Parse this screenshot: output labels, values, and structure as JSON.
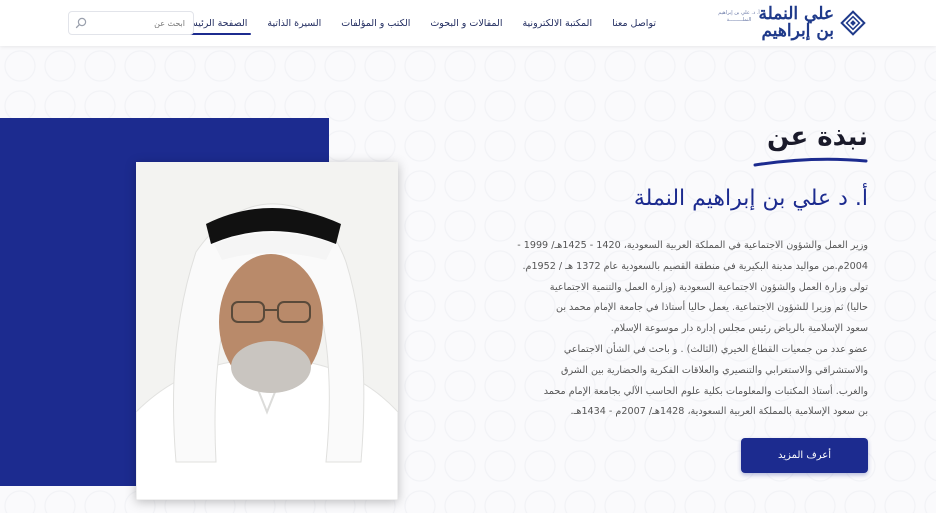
{
  "header": {
    "logo": {
      "name_lines": [
        "علي النملة",
        "بن إبراهيم"
      ],
      "sub_lines": [
        "أ. د. علي بن إبراهيم",
        "النملـــــــــة"
      ]
    },
    "nav": [
      {
        "label": "الصفحة الرئيسية",
        "active": true
      },
      {
        "label": "السيرة الذاتية",
        "active": false
      },
      {
        "label": "الكتب و المؤلفات",
        "active": false
      },
      {
        "label": "المقالات و البحوث",
        "active": false
      },
      {
        "label": "المكتبة الالكترونية",
        "active": false
      },
      {
        "label": "تواصل معنا",
        "active": false
      }
    ],
    "search": {
      "placeholder": "ابحث عن",
      "value": ""
    }
  },
  "about": {
    "section_title": "نبذة عن",
    "name": "أ. د علي بن إبراهيم النملة",
    "bio_lines": [
      "وزير العمل والشؤون الاجتماعية في المملكة العربية السعودية، 1420 - 1425هـ/ 1999 -",
      "2004م.من مواليد مدينة البكيرية في منطقة القصيم بالسعودية عام 1372 هـ / 1952م.",
      "تولى وزارة العمل والشؤون الاجتماعية السعودية (وزارة العمل والتنمية الاجتماعية",
      "حاليا) ثم وزيرا للشؤون الاجتماعية. يعمل حاليا أستاذا في جامعة الإمام محمد بن",
      "سعود الإسلامية بالرياض رئيس مجلس إدارة دار موسوعة الإسلام.",
      "عضو عدد من جمعيات القطاع الخيري (الثالث) . و باحث في الشأن الاجتماعي",
      "والاستشراقي والاستغرابي والتنصيري والعلاقات الفكرية والحضارية بين الشرق",
      "والغرب. أستاذ المكتبات والمعلومات بكلية علوم الحاسب الآلي بجامعة الإمام محمد",
      "بن سعود الإسلامية بالمملكة العربية السعودية، 1428هـ/ 2007م - 1434هـ."
    ],
    "more_button": "أعرف المزيد"
  },
  "colors": {
    "primary": "#1c2b8f",
    "heading": "#1a1a2a",
    "body_text": "#555555"
  },
  "icons": {
    "logo": "geometric-diamond-logo-icon",
    "search": "search-icon"
  }
}
